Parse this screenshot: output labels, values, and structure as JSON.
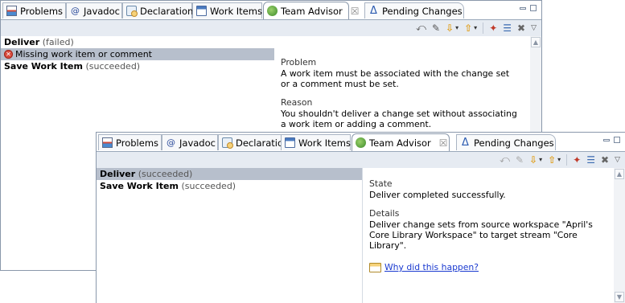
{
  "tabs": [
    {
      "label": "Problems",
      "icon": "problems-icon"
    },
    {
      "label": "Javadoc",
      "icon": "javadoc-icon"
    },
    {
      "label": "Declaration",
      "icon": "declaration-icon"
    },
    {
      "label": "Work Items",
      "icon": "work-items-icon"
    },
    {
      "label": "Team Advisor",
      "icon": "team-advisor-icon",
      "close": "☒"
    },
    {
      "label": "Pending Changes",
      "icon": "delta-icon"
    }
  ],
  "back_view": {
    "items": [
      {
        "name": "Deliver",
        "status": "(failed)"
      },
      {
        "name": "Missing work item or comment"
      },
      {
        "name": "Save Work Item",
        "status": "(succeeded)"
      }
    ],
    "detail": {
      "section1_title": "Problem",
      "section1_text": "A work item must be associated with the change set or a comment must be set.",
      "section2_title": "Reason",
      "section2_text": "You shouldn't deliver a change set without associating a work item or adding a comment."
    }
  },
  "front_view": {
    "items": [
      {
        "name": "Deliver",
        "status": "(succeeded)"
      },
      {
        "name": "Save Work Item",
        "status": "(succeeded)"
      }
    ],
    "detail": {
      "section1_title": "State",
      "section1_text": "Deliver completed successfully.",
      "section2_title": "Details",
      "section2_text": "Deliver change sets from source workspace \"April's Core Library Workspace\" to target stream \"Core Library\".",
      "link_text": "Why did this happen?"
    }
  },
  "colors": {
    "selection": "#b7bfcc",
    "toolbar_bg": "#e6ebf2",
    "link": "#1a3ad0",
    "error": "#d94a3d"
  }
}
